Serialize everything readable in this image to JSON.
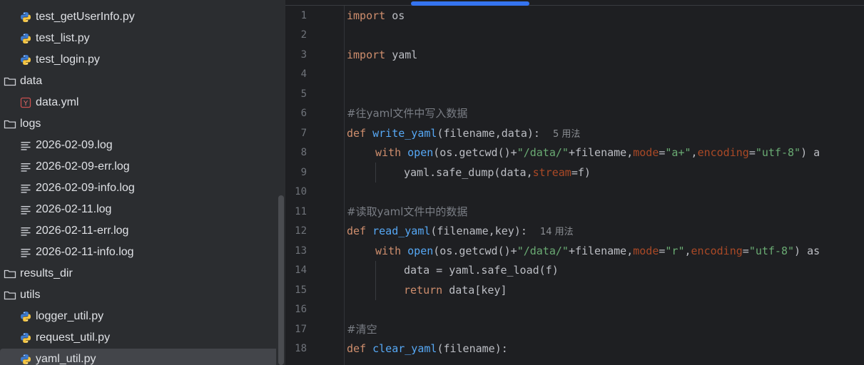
{
  "sidebar": {
    "items": [
      {
        "label": "test_getUserInfo.py",
        "type": "python",
        "level": 1
      },
      {
        "label": "test_list.py",
        "type": "python",
        "level": 1
      },
      {
        "label": "test_login.py",
        "type": "python",
        "level": 1
      },
      {
        "label": "data",
        "type": "folder",
        "level": 0
      },
      {
        "label": "data.yml",
        "type": "yaml",
        "level": 1
      },
      {
        "label": "logs",
        "type": "folder",
        "level": 0
      },
      {
        "label": "2026-02-09.log",
        "type": "log",
        "level": 1
      },
      {
        "label": "2026-02-09-err.log",
        "type": "log",
        "level": 1
      },
      {
        "label": "2026-02-09-info.log",
        "type": "log",
        "level": 1
      },
      {
        "label": "2026-02-11.log",
        "type": "log",
        "level": 1
      },
      {
        "label": "2026-02-11-err.log",
        "type": "log",
        "level": 1
      },
      {
        "label": "2026-02-11-info.log",
        "type": "log",
        "level": 1
      },
      {
        "label": "results_dir",
        "type": "folder",
        "level": 0
      },
      {
        "label": "utils",
        "type": "folder",
        "level": 0
      },
      {
        "label": "logger_util.py",
        "type": "python",
        "level": 1
      },
      {
        "label": "request_util.py",
        "type": "python",
        "level": 1
      },
      {
        "label": "yaml_util.py",
        "type": "python",
        "level": 1,
        "selected": true
      }
    ]
  },
  "editor": {
    "line_numbers": [
      "1",
      "2",
      "3",
      "4",
      "5",
      "6",
      "7",
      "8",
      "9",
      "10",
      "11",
      "12",
      "13",
      "14",
      "15",
      "16",
      "17",
      "18"
    ],
    "l1": {
      "kw": "import",
      "mod": " os"
    },
    "l3": {
      "kw": "import",
      "mod": " yaml"
    },
    "l6": {
      "comment": "#往yaml文件中写入数据"
    },
    "l7": {
      "kw": "def",
      "fn": "write_yaml",
      "args": "(filename,data):",
      "hint": "5 用法"
    },
    "l8": {
      "kw": "with",
      "fn": "open",
      "p1": "(os.getcwd()+",
      "s1": "\"/data/\"",
      "p2": "+filename,",
      "k1": "mode",
      "p3": "=",
      "s2": "\"a+\"",
      "p4": ",",
      "k2": "encoding",
      "p5": "=",
      "s3": "\"utf-8\"",
      "p6": ") a"
    },
    "l9": {
      "p1": "yaml.safe_dump(data,",
      "k1": "stream",
      "p2": "=f)"
    },
    "l11": {
      "comment": "#读取yaml文件中的数据"
    },
    "l12": {
      "kw": "def",
      "fn": "read_yaml",
      "args": "(filename,key):",
      "hint": "14 用法"
    },
    "l13": {
      "kw": "with",
      "fn": "open",
      "p1": "(os.getcwd()+",
      "s1": "\"/data/\"",
      "p2": "+filename,",
      "k1": "mode",
      "p3": "=",
      "s2": "\"r\"",
      "p4": ",",
      "k2": "encoding",
      "p5": "=",
      "s3": "\"utf-8\"",
      "p6": ") as"
    },
    "l14": {
      "text": "data = yaml.safe_load(f)"
    },
    "l15": {
      "kw": "return",
      "rest": " data[key]"
    },
    "l17": {
      "comment": "#清空"
    },
    "l18": {
      "kw": "def",
      "fn": "clear_yaml",
      "args": "(filename):"
    }
  },
  "colors": {
    "keyword": "#cf8e6d",
    "function": "#56a8f5",
    "string": "#6aab73",
    "param": "#aa4926",
    "comment": "#7a7e85",
    "accent": "#3574f0"
  }
}
